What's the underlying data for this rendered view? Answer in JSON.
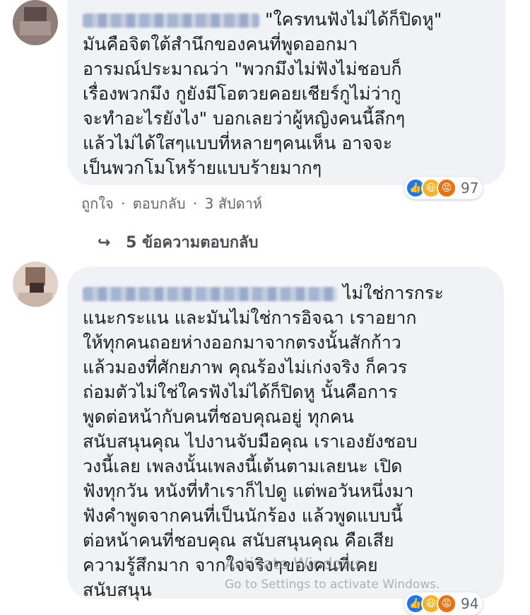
{
  "comment1": {
    "quote": "\"ใครทนฟังไม่ได้ก็ปิดหู\"",
    "lines": [
      "มันคือจิตใต้สำนึกของคนที่พูดออกมา",
      "อารมณ์ประมาณว่า \"พวกมึงไม่ฟังไม่ชอบก็",
      "เรื่องพวกมึง กูยังมีโอตวยคอยเชียร์กูไม่ว่ากู",
      "จะทำอะไรยังไง\" บอกเลยว่าผู้หญิงคนนี้ลึกๆ",
      "แล้วไม่ได้ใสๆแบบที่หลายๆคนเห็น อาจจะ",
      "เป็นพวกโมโหร้ายแบบร้ายมากๆ"
    ],
    "like": "ถูกใจ",
    "reply": "ตอบกลับ",
    "time": "3 สัปดาห์",
    "reaction_count": "97",
    "replies_label": "5 ข้อความตอบกลับ"
  },
  "comment2": {
    "lines": [
      "ไม่ใช่การกระ",
      "แนะกระแน และมันไม่ใช่การอิจฉา เราอยาก",
      "ให้ทุกคนถอยห่างออกมาจากตรงนั้นสักก้าว",
      "แล้วมองที่ศักยภาพ คุณร้องไม่เก่งจริง ก็ควร",
      "ถ่อมตัวไม่ใช่ใครฟังไม่ได้ก็ปิดหู นั้นคือการ",
      "พูดต่อหน้ากับคนที่ชอบคุณอยู่ ทุกคน",
      "สนับสนุนคุณ ไปงานจับมือคุณ เราเองยังชอบ",
      "วงนี้เลย เพลงนั้นเพลงนี้เต้นตามเลยนะ เปิด",
      "ฟังทุกวัน หนังที่ทำเราก็ไปดู แต่พอวันหนึ่งมา",
      "ฟังคำพูดจากคนที่เป็นนักร้อง แล้วพูดแบบนี้",
      "ต่อหน้าคนที่ชอบคุณ สนับสนุนคุณ คือเสีย",
      "ความรู้สึกมาก จากใจจริงๆของคนที่เคย",
      "สนับสนุน"
    ],
    "reaction_count": "94"
  },
  "watermark": {
    "title": "Activate Windows",
    "subtitle": "Go to Settings to activate Windows."
  },
  "colors": {
    "bubble": "#f0f2f5",
    "like": "#1877f2",
    "haha": "#f7b125",
    "angry": "#e9710f"
  }
}
